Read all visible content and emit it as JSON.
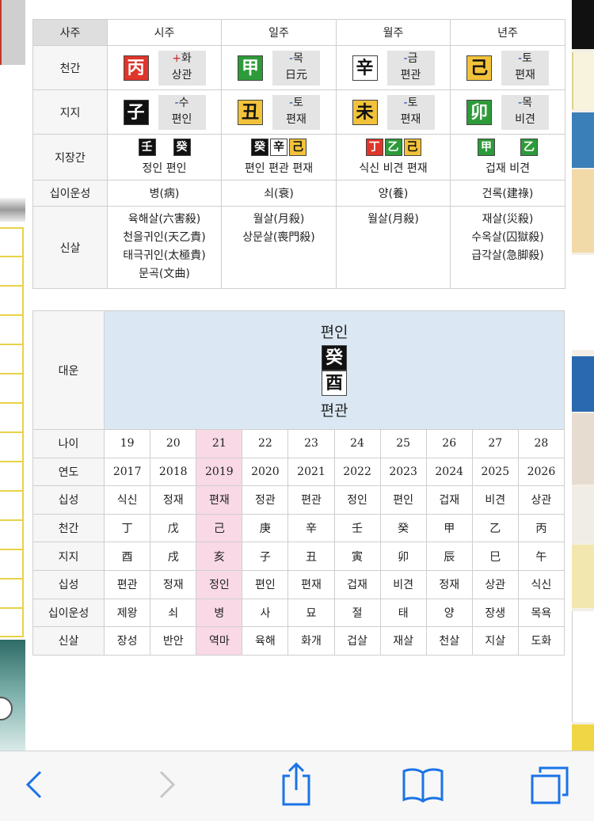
{
  "saju": {
    "header": [
      "사주",
      "시주",
      "일주",
      "월주",
      "년주"
    ],
    "rows": {
      "cheongan_label": "천간",
      "jiji_label": "지지",
      "jijanggan_label": "지장간",
      "unseong_label": "십이운성",
      "sinsal_label": "신살"
    },
    "cheongan": [
      {
        "char": "丙",
        "color": "#e0352a",
        "sign": "+",
        "element": "화",
        "god": "상관"
      },
      {
        "char": "甲",
        "color": "#2e9b3a",
        "sign": "-",
        "element": "목",
        "god": "日元"
      },
      {
        "char": "辛",
        "color": "#ffffff",
        "sign": "-",
        "element": "금",
        "god": "편관"
      },
      {
        "char": "己",
        "color": "#f2c23a",
        "sign": "-",
        "element": "토",
        "god": "편재"
      }
    ],
    "jiji": [
      {
        "char": "子",
        "color": "#111111",
        "sign": "-",
        "element": "수",
        "god": "편인"
      },
      {
        "char": "丑",
        "color": "#f2c23a",
        "sign": "-",
        "element": "토",
        "god": "편재"
      },
      {
        "char": "未",
        "color": "#f2c23a",
        "sign": "-",
        "element": "토",
        "god": "편재"
      },
      {
        "char": "卯",
        "color": "#2e9b3a",
        "sign": "-",
        "element": "목",
        "god": "비견"
      }
    ],
    "jijanggan": [
      {
        "chars": [
          "壬",
          "癸"
        ],
        "gods": "정인 편인"
      },
      {
        "chars": [
          "癸",
          "辛",
          "己"
        ],
        "gods": "편인 편관 편재"
      },
      {
        "chars": [
          "丁",
          "乙",
          "己"
        ],
        "gods": "식신 비견 편재"
      },
      {
        "chars": [
          "甲",
          "乙"
        ],
        "gods": "겁재 비견"
      }
    ],
    "unseong": [
      "병(病)",
      "쇠(衰)",
      "양(養)",
      "건록(建祿)"
    ],
    "sinsal": [
      [
        "육해살(六害殺)",
        "천을귀인(天乙貴)",
        "태극귀인(太極貴)",
        "문곡(文曲)"
      ],
      [
        "월살(月殺)",
        "상문살(喪門殺)"
      ],
      [
        "월살(月殺)"
      ],
      [
        "재살(災殺)",
        "수옥살(囚獄殺)",
        "급각살(急脚殺)"
      ]
    ]
  },
  "daeun": {
    "label": "대운",
    "current": {
      "top_god": "편인",
      "stem": "癸",
      "branch": "酉",
      "bottom_god": "편관"
    },
    "row_labels": [
      "나이",
      "연도",
      "십성",
      "천간",
      "지지",
      "십성",
      "십이운성",
      "신살"
    ],
    "ages": [
      "19",
      "20",
      "21",
      "22",
      "23",
      "24",
      "25",
      "26",
      "27",
      "28"
    ],
    "years": [
      "2017",
      "2018",
      "2019",
      "2020",
      "2021",
      "2022",
      "2023",
      "2024",
      "2025",
      "2026"
    ],
    "stem_gods": [
      "식신",
      "정재",
      "편재",
      "정관",
      "편관",
      "정인",
      "편인",
      "겁재",
      "비견",
      "상관"
    ],
    "stems": [
      "丁",
      "戊",
      "己",
      "庚",
      "辛",
      "壬",
      "癸",
      "甲",
      "乙",
      "丙"
    ],
    "branches": [
      "酉",
      "戌",
      "亥",
      "子",
      "丑",
      "寅",
      "卯",
      "辰",
      "巳",
      "午"
    ],
    "branch_gods": [
      "편관",
      "정재",
      "정인",
      "편인",
      "편재",
      "겁재",
      "비견",
      "정재",
      "상관",
      "식신"
    ],
    "unseong": [
      "제왕",
      "쇠",
      "병",
      "사",
      "묘",
      "절",
      "태",
      "양",
      "장생",
      "목욕"
    ],
    "sinsal": [
      "장성",
      "반안",
      "역마",
      "육해",
      "화개",
      "겁살",
      "재살",
      "천살",
      "지살",
      "도화"
    ],
    "highlight_index": 2,
    "highlight_color": "#f9d9e6",
    "panel_color": "#dbe8f3"
  },
  "toolbar": {
    "icons": [
      "back-icon",
      "forward-icon",
      "share-icon",
      "bookmarks-icon",
      "tabs-icon"
    ],
    "accent": "#1a73e8"
  }
}
